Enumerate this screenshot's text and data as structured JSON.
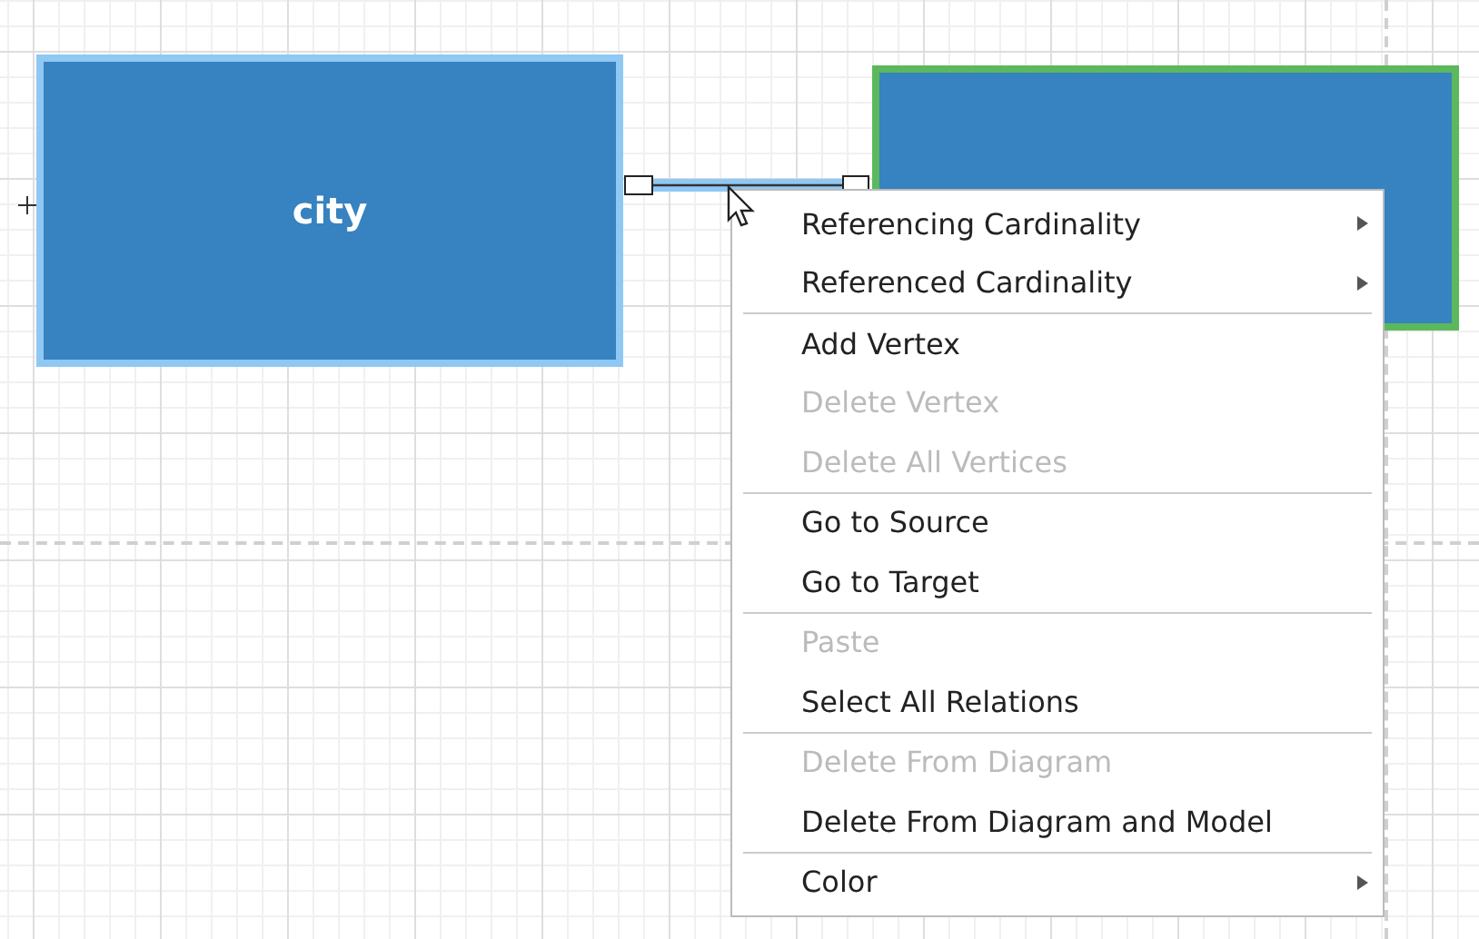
{
  "diagram": {
    "entities": [
      {
        "label": "city",
        "color": "#90c8f4"
      },
      {
        "color": "#5cb85c"
      }
    ],
    "relation": {
      "selected": true
    }
  },
  "context_menu": {
    "groups": [
      [
        {
          "label": "Referencing Cardinality",
          "disabled": false,
          "submenu": true
        },
        {
          "label": "Referenced Cardinality",
          "disabled": false,
          "submenu": true
        }
      ],
      [
        {
          "label": "Add Vertex",
          "disabled": false,
          "submenu": false
        },
        {
          "label": "Delete Vertex",
          "disabled": true,
          "submenu": false
        },
        {
          "label": "Delete All Vertices",
          "disabled": true,
          "submenu": false
        }
      ],
      [
        {
          "label": "Go to Source",
          "disabled": false,
          "submenu": false
        },
        {
          "label": "Go to Target",
          "disabled": false,
          "submenu": false
        }
      ],
      [
        {
          "label": "Paste",
          "disabled": true,
          "submenu": false
        },
        {
          "label": "Select All Relations",
          "disabled": false,
          "submenu": false
        }
      ],
      [
        {
          "label": "Delete From Diagram",
          "disabled": true,
          "submenu": false
        },
        {
          "label": "Delete From Diagram and Model",
          "disabled": false,
          "submenu": false
        }
      ],
      [
        {
          "label": "Color",
          "disabled": false,
          "submenu": true
        }
      ]
    ]
  }
}
